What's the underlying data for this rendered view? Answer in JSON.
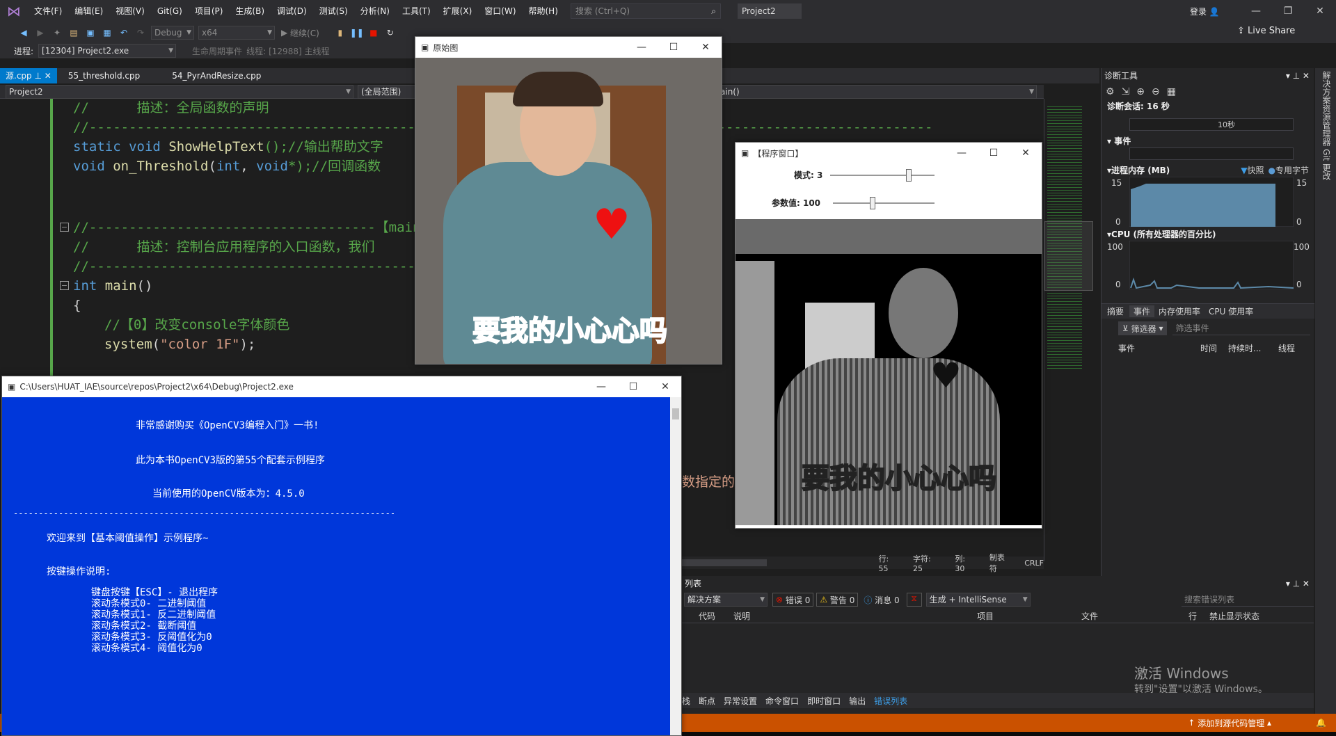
{
  "menubar": {
    "items": [
      "文件(F)",
      "编辑(E)",
      "视图(V)",
      "Git(G)",
      "项目(P)",
      "生成(B)",
      "调试(D)",
      "测试(S)",
      "分析(N)",
      "工具(T)",
      "扩展(X)",
      "窗口(W)",
      "帮助(H)"
    ],
    "search_placeholder": "搜索 (Ctrl+Q)",
    "project_title": "Project2",
    "login": "登录"
  },
  "toolbar": {
    "config": "Debug",
    "platform": "x64",
    "continue_label": "继续(C)",
    "live_share": "Live Share"
  },
  "procbar": {
    "process_label": "进程:",
    "process_value": "[12304] Project2.exe",
    "lifecycle": "生命周期事件",
    "thread_label": "线程:",
    "thread_value": "[12988] 主线程"
  },
  "tabs": [
    "源.cpp",
    "55_threshold.cpp",
    "54_PyrAndResize.cpp"
  ],
  "navbar": {
    "project": "Project2",
    "scope": "(全局范围)",
    "member": "ain()"
  },
  "code": {
    "l1": "//      描述：全局函数的声明",
    "l2": "//----------------------------------------------------------------------------------------------------------",
    "l3a": "static",
    "l3b": "void",
    "l3c": "ShowHelpText",
    "l3d": "();//输出帮助文字",
    "l4a": "void",
    "l4b": "on_Threshold",
    "l4c": "(",
    "l4d": "int",
    ", ": "",
    "l4e": ", ",
    "l4f": "void",
    "l4g": "*);//回调函数",
    "l5": "//------------------------------------【main",
    "l6": "//      描述：控制台应用程序的入口函数，我们",
    "l7": "//--------------------------------------------------------",
    "l8a": "int",
    "l8b": "main",
    "l8c": "()",
    "l9": "{",
    "l10": "//【0】改变console字体颜色",
    "l11a": "system",
    "l11b": "(",
    "l11c": "\"color 1F\"",
    "l11d": ");",
    "partial": "数指定的"
  },
  "editor_status": {
    "line": "行: 55",
    "char": "字符: 25",
    "col": "列: 30",
    "tabs": "制表符",
    "eol": "CRLF"
  },
  "diag": {
    "title": "诊断工具",
    "session": "诊断会话: 16 秒",
    "timeline": "10秒",
    "events": "事件",
    "memory": "进程内存 (MB)",
    "snapshot": "快照",
    "private_bytes": "专用字节",
    "mem_max": "15",
    "mem_min": "0",
    "mem_max_r": "15",
    "mem_min_r": "0",
    "cpu": "CPU (所有处理器的百分比)",
    "cpu_max": "100",
    "cpu_min": "0",
    "cpu_max_r": "100",
    "cpu_min_r": "0",
    "tabs": [
      "摘要",
      "事件",
      "内存使用率",
      "CPU 使用率"
    ],
    "filter": "筛选器",
    "filter_placeholder": "筛选事件",
    "cols": [
      "事件",
      "时间",
      "持续时...",
      "线程"
    ]
  },
  "sidestrip": [
    "解决方案资源管理器",
    "Git 更改"
  ],
  "errors": {
    "title": "列表",
    "scope": "解决方案",
    "errors": "错误 0",
    "warnings": "警告 0",
    "messages": "消息 0",
    "build": "生成 + IntelliSense",
    "search_placeholder": "搜索错误列表",
    "cols": [
      "代码",
      "说明",
      "项目",
      "文件",
      "行",
      "禁止显示状态"
    ],
    "watermark1": "激活 Windows",
    "watermark2": "转到\"设置\"以激活 Windows。"
  },
  "bottomtabs": [
    "栈",
    "断点",
    "异常设置",
    "命令窗口",
    "即时窗口",
    "输出",
    "错误列表"
  ],
  "statusbar": {
    "source_control": "添加到源代码管理"
  },
  "console": {
    "title": "C:\\Users\\HUAT_IAE\\source\\repos\\Project2\\x64\\Debug\\Project2.exe",
    "line1": "非常感谢购买《OpenCV3编程入门》一书!",
    "line2": "此为本书OpenCV3版的第55个配套示例程序",
    "line3": "当前使用的OpenCV版本为：4.5.0",
    "line4": "----------------------------------------------------------------------------",
    "line5": "欢迎来到【基本阈值操作】示例程序~",
    "line6": "按键操作说明:",
    "line7": "键盘按键【ESC】- 退出程序",
    "line8": "滚动条模式0- 二进制阈值",
    "line9": "滚动条模式1- 反二进制阈值",
    "line10": "滚动条模式2- 截断阈值",
    "line11": "滚动条模式3- 反阈值化为0",
    "line12": "滚动条模式4- 阈值化为0"
  },
  "origwin": {
    "title": "原始图",
    "caption": "要我的小心心吗"
  },
  "progwin": {
    "title": "【程序窗口】",
    "mode_label": "模式: 3",
    "param_label": "参数值: 100",
    "mode_value": 3,
    "mode_max": 4,
    "param_value": 100,
    "param_max": 255,
    "caption": "要我的小心心吗"
  }
}
